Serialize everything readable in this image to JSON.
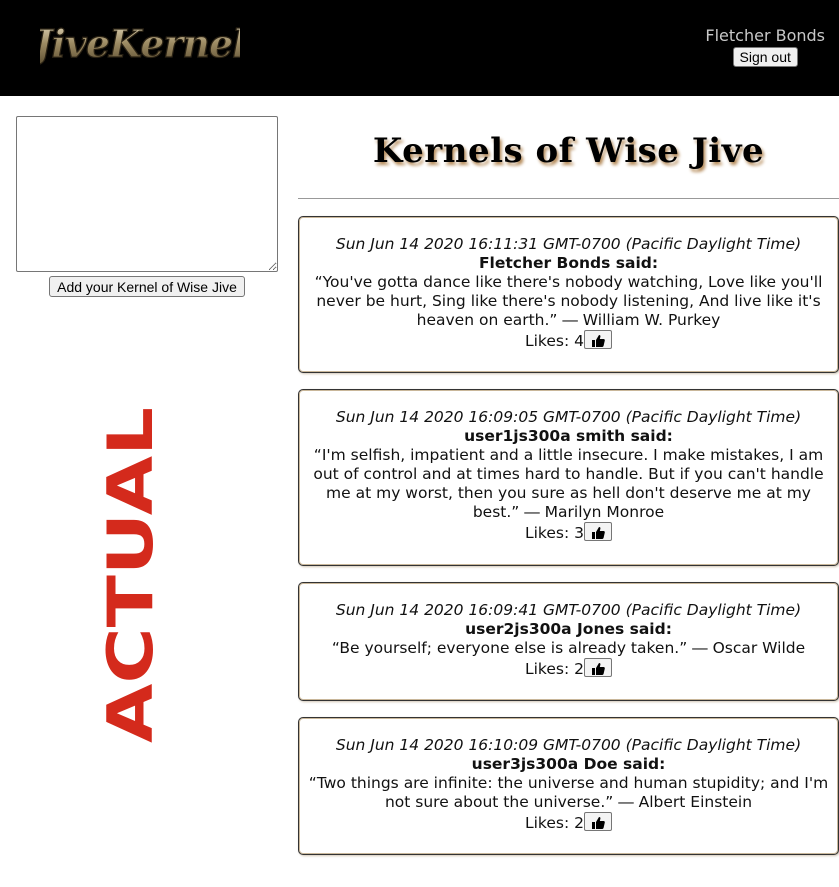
{
  "header": {
    "logo_text": "JiveKernel",
    "user_name": "Fletcher Bonds",
    "signout_label": "Sign out"
  },
  "composer": {
    "textarea_value": "",
    "add_button_label": "Add your Kernel of Wise Jive"
  },
  "watermark": {
    "text": "ACTUAL",
    "color": "#d42a1c"
  },
  "main": {
    "title": "Kernels of Wise Jive"
  },
  "posts": [
    {
      "timestamp": "Sun Jun 14 2020 16:11:31 GMT-0700 (Pacific Daylight Time)",
      "author": "Fletcher Bonds",
      "said_suffix": " said:",
      "quote": "“You've gotta dance like there's nobody watching, Love like you'll never be hurt, Sing like there's nobody listening, And live like it's heaven on earth.” ― William W. Purkey",
      "likes_label": "Likes: ",
      "likes": "4"
    },
    {
      "timestamp": "Sun Jun 14 2020 16:09:05 GMT-0700 (Pacific Daylight Time)",
      "author": "user1js300a smith",
      "said_suffix": " said:",
      "quote": "“I'm selfish, impatient and a little insecure. I make mistakes, I am out of control and at times hard to handle. But if you can't handle me at my worst, then you sure as hell don't deserve me at my best.” ― Marilyn Monroe",
      "likes_label": "Likes: ",
      "likes": "3"
    },
    {
      "timestamp": "Sun Jun 14 2020 16:09:41 GMT-0700 (Pacific Daylight Time)",
      "author": "user2js300a Jones",
      "said_suffix": " said:",
      "quote": "“Be yourself; everyone else is already taken.” ― Oscar Wilde",
      "likes_label": "Likes: ",
      "likes": "2"
    },
    {
      "timestamp": "Sun Jun 14 2020 16:10:09 GMT-0700 (Pacific Daylight Time)",
      "author": "user3js300a Doe",
      "said_suffix": " said:",
      "quote": "“Two things are infinite: the universe and human stupidity; and I'm not sure about the universe.” ― Albert Einstein",
      "likes_label": "Likes: ",
      "likes": "2"
    }
  ]
}
